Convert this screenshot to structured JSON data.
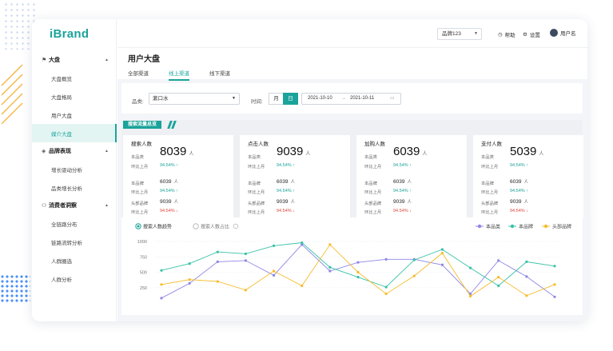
{
  "app": {
    "logo": "iBrand",
    "brand_select": "品牌123",
    "help": "帮助",
    "settings": "设置",
    "user": "用户名"
  },
  "sidebar": {
    "groups": [
      {
        "label": "大盘",
        "items": [
          "大盘概览",
          "大盘格局",
          "用户大盘",
          "媒介大盘"
        ]
      },
      {
        "label": "品牌表现",
        "items": [
          "增长驱动分析",
          "品类增长分析"
        ]
      },
      {
        "label": "消费者洞察",
        "items": [
          "全链路分布",
          "链路流转分析",
          "人群圈选",
          "人群分析"
        ]
      }
    ],
    "active_item": "媒介大盘"
  },
  "page": {
    "title": "用户大盘",
    "tabs": [
      "全部渠道",
      "线上渠道",
      "线下渠道"
    ],
    "active_tab": "线上渠道"
  },
  "filter": {
    "category_label": "品类:",
    "category_value": "漱口水",
    "time_label": "时间:",
    "period_options": [
      "月",
      "日"
    ],
    "active_period": "日",
    "date_start": "2021-10-10",
    "date_sep": "→",
    "date_end": "2021-10-11"
  },
  "section": {
    "title": "搜索流量总览"
  },
  "kpis": [
    {
      "name": "搜索人数",
      "main_label": "本品类",
      "main_value": "8039",
      "unit": "人",
      "mom_label": "环比上月",
      "mom": "94.54%",
      "mom_dir": "up",
      "rows": [
        {
          "label": "本品牌",
          "value": "6039",
          "mom_label": "环比上月",
          "mom": "94.54%",
          "dir": "up"
        },
        {
          "label": "头部品牌",
          "value": "9039",
          "mom_label": "环比上月",
          "mom": "94.54%",
          "dir": "down"
        }
      ]
    },
    {
      "name": "点击人数",
      "main_label": "本品类",
      "main_value": "9039",
      "unit": "人",
      "mom_label": "环比上月",
      "mom": "94.54%",
      "mom_dir": "up",
      "rows": [
        {
          "label": "本品牌",
          "value": "6039",
          "mom_label": "环比上月",
          "mom": "94.54%",
          "dir": "up"
        },
        {
          "label": "头部品牌",
          "value": "9039",
          "mom_label": "环比上月",
          "mom": "94.54%",
          "dir": "down"
        }
      ]
    },
    {
      "name": "加购人数",
      "main_label": "本品类",
      "main_value": "6039",
      "unit": "人",
      "mom_label": "环比上月",
      "mom": "94.54%",
      "mom_dir": "up",
      "rows": [
        {
          "label": "本品牌",
          "value": "6039",
          "mom_label": "环比上月",
          "mom": "94.54%",
          "dir": "up"
        },
        {
          "label": "头部品牌",
          "value": "9039",
          "mom_label": "环比上月",
          "mom": "94.54%",
          "dir": "down"
        }
      ]
    },
    {
      "name": "支付人数",
      "main_label": "本品类",
      "main_value": "5039",
      "unit": "人",
      "mom_label": "环比上月",
      "mom": "94.54%",
      "mom_dir": "up",
      "rows": [
        {
          "label": "本品牌",
          "value": "6039",
          "mom_label": "环比上月",
          "mom": "94.54%",
          "dir": "up"
        },
        {
          "label": "头部品牌",
          "value": "9039",
          "mom_label": "环比上月",
          "mom": "94.54%",
          "dir": "down"
        }
      ]
    }
  ],
  "chart_controls": {
    "radio_on": "搜索人数趋势",
    "radio_off": "搜索人数占比"
  },
  "colors": {
    "accent": "#1aa39a",
    "up": "#1aa39a",
    "down": "#e0463a"
  },
  "chart_data": {
    "type": "line",
    "ylim": [
      0,
      1000
    ],
    "yticks": [
      "1000",
      "750",
      "500",
      "250"
    ],
    "x_count": 15,
    "grid": true,
    "legend_position": "top-right",
    "series": [
      {
        "name": "本品类",
        "color": "#8f86e6",
        "values": [
          80,
          320,
          670,
          690,
          450,
          950,
          520,
          660,
          710,
          710,
          620,
          150,
          690,
          430,
          100
        ]
      },
      {
        "name": "本品牌",
        "color": "#38c2a7",
        "values": [
          530,
          640,
          830,
          800,
          930,
          980,
          580,
          420,
          260,
          700,
          870,
          570,
          280,
          670,
          600
        ]
      },
      {
        "name": "头部品牌",
        "color": "#f5bd2d",
        "values": [
          300,
          380,
          350,
          210,
          520,
          280,
          950,
          500,
          150,
          440,
          810,
          110,
          420,
          120,
          300
        ]
      }
    ]
  }
}
